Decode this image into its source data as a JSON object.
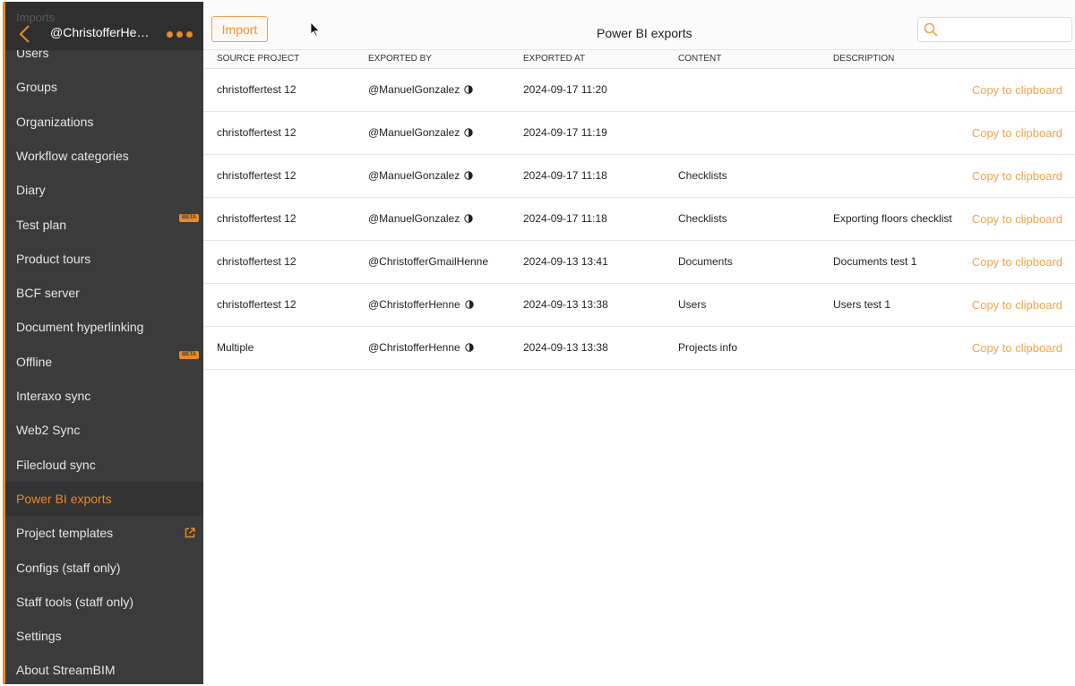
{
  "sidebar": {
    "ghost_label": "Imports",
    "account_name": "@ChristofferHenne",
    "items": [
      {
        "label": "Users"
      },
      {
        "label": "Groups"
      },
      {
        "label": "Organizations"
      },
      {
        "label": "Workflow categories"
      },
      {
        "label": "Diary"
      },
      {
        "label": "Test plan",
        "badge": "BETA"
      },
      {
        "label": "Product tours"
      },
      {
        "label": "BCF server"
      },
      {
        "label": "Document hyperlinking"
      },
      {
        "label": "Offline",
        "badge": "BETA"
      },
      {
        "label": "Interaxo sync"
      },
      {
        "label": "Web2 Sync"
      },
      {
        "label": "Filecloud sync"
      },
      {
        "label": "Power BI exports",
        "active": true
      },
      {
        "label": "Project templates",
        "icon": "external-link-icon"
      },
      {
        "label": "Configs (staff only)"
      },
      {
        "label": "Staff tools (staff only)"
      },
      {
        "label": "Settings"
      },
      {
        "label": "About StreamBIM"
      }
    ]
  },
  "toolbar": {
    "import_label": "Import",
    "page_title": "Power BI exports",
    "search_placeholder": ""
  },
  "table": {
    "columns": [
      "Source project",
      "Exported by",
      "Exported at",
      "Content",
      "Description"
    ],
    "copy_label": "Copy to clipboard",
    "rows": [
      {
        "source": "christoffertest 12",
        "by": "@ManuelGonzalez",
        "by_icon": true,
        "at": "2024-09-17 11:20",
        "content": "",
        "desc": ""
      },
      {
        "source": "christoffertest 12",
        "by": "@ManuelGonzalez",
        "by_icon": true,
        "at": "2024-09-17 11:19",
        "content": "",
        "desc": ""
      },
      {
        "source": "christoffertest 12",
        "by": "@ManuelGonzalez",
        "by_icon": true,
        "at": "2024-09-17 11:18",
        "content": "Checklists",
        "desc": ""
      },
      {
        "source": "christoffertest 12",
        "by": "@ManuelGonzalez",
        "by_icon": true,
        "at": "2024-09-17 11:18",
        "content": "Checklists",
        "desc": "Exporting floors checklist"
      },
      {
        "source": "christoffertest 12",
        "by": "@ChristofferGmailHenne",
        "by_icon": false,
        "at": "2024-09-13 13:41",
        "content": "Documents",
        "desc": "Documents test 1"
      },
      {
        "source": "christoffertest 12",
        "by": "@ChristofferHenne",
        "by_icon": true,
        "at": "2024-09-13 13:38",
        "content": "Users",
        "desc": "Users test 1"
      },
      {
        "source": "Multiple",
        "by": "@ChristofferHenne",
        "by_icon": true,
        "at": "2024-09-13 13:38",
        "content": "Projects info",
        "desc": ""
      }
    ]
  },
  "colors": {
    "accent": "#e88a25",
    "sidebar_bg": "#3b3b3b",
    "link": "#f2a24a"
  }
}
